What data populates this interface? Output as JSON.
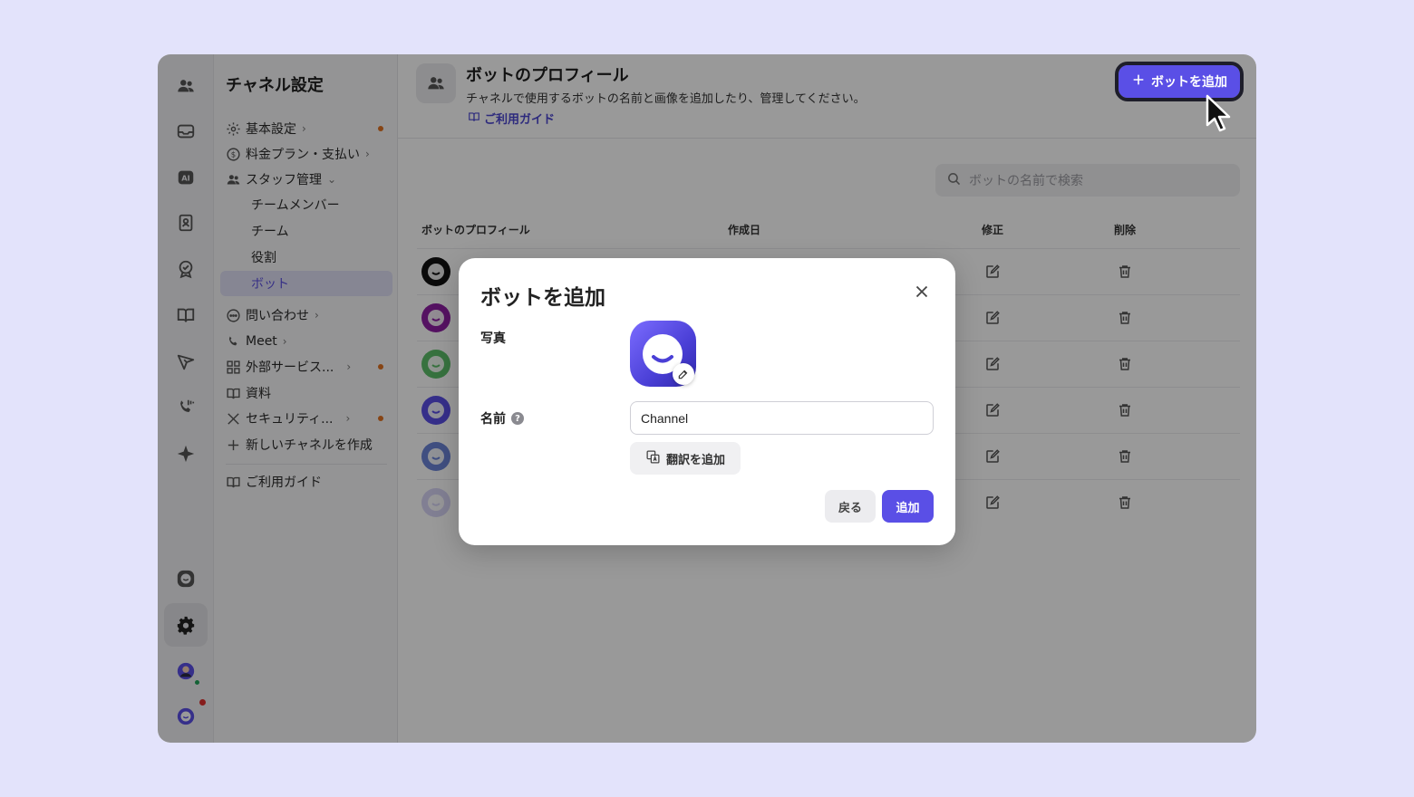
{
  "sidebar": {
    "title": "チャネル設定",
    "items": [
      {
        "label": "基本設定",
        "icon": "gear-icon"
      },
      {
        "label": "料金プラン・支払い",
        "icon": "dollar-icon"
      },
      {
        "label": "スタッフ管理",
        "icon": "staff-icon"
      },
      {
        "label": "問い合わせ",
        "icon": "chat-icon"
      },
      {
        "label": "Meet",
        "icon": "phone-icon"
      },
      {
        "label": "外部サービス...",
        "icon": "grid-icon"
      },
      {
        "label": "資料",
        "icon": "book-icon"
      },
      {
        "label": "セキュリティ...",
        "icon": "tools-icon"
      },
      {
        "label": "新しいチャネルを作成",
        "icon": "plus-icon"
      }
    ],
    "staff_sub": [
      "チームメンバー",
      "チーム",
      "役割",
      "ボット"
    ],
    "guide": "ご利用ガイド"
  },
  "header": {
    "title": "ボットのプロフィール",
    "description": "チャネルで使用するボットの名前と画像を追加したり、管理してください。",
    "guide_link": "ご利用ガイド",
    "add_button": "ボットを追加"
  },
  "search": {
    "placeholder": "ボットの名前で検索"
  },
  "table": {
    "columns": [
      "ボットのプロフィール",
      "作成日",
      "修正",
      "削除"
    ],
    "rows": [
      {
        "avatar_color": "#111111"
      },
      {
        "avatar_color": "#8e1fa3"
      },
      {
        "avatar_color": "#5cbf6a"
      },
      {
        "avatar_color": "#5a4fe6"
      },
      {
        "avatar_color": "#6b84d8"
      },
      {
        "avatar_color": "#d8d4f6"
      }
    ]
  },
  "modal": {
    "title": "ボットを追加",
    "photo_label": "写真",
    "name_label": "名前",
    "help": "?",
    "name_value": "Channel",
    "translate_button": "翻訳を追加",
    "back_button": "戻る",
    "add_button": "追加"
  },
  "colors": {
    "accent": "#5a4fe6",
    "alert": "#e07222"
  }
}
